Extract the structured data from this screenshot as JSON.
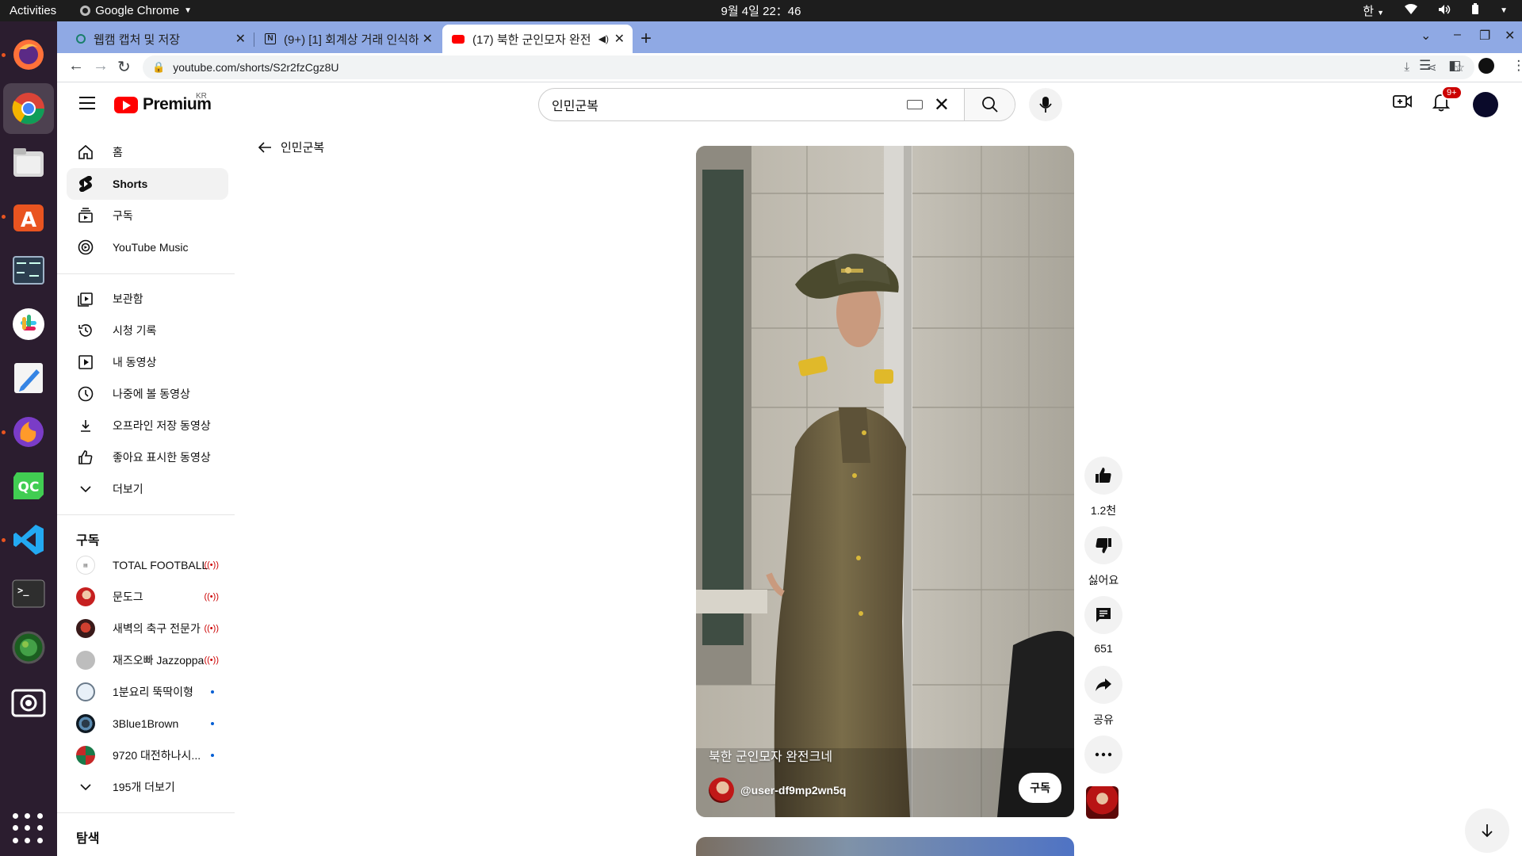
{
  "os_bar": {
    "activities": "Activities",
    "app_name": "Google Chrome",
    "clock": "9월 4일  22：46",
    "input_method": "한"
  },
  "browser": {
    "tabs": [
      {
        "title": "웹캠 캡처 및 저장"
      },
      {
        "title": "(9+) [1] 회계상 거래 인식하기"
      },
      {
        "title": "(17) 북한 군인모자 완전크네"
      }
    ],
    "url": "youtube.com/shorts/S2r2fzCgz8U"
  },
  "youtube": {
    "logo_text": "Premium",
    "region": "KR",
    "search_value": "인민군복",
    "notification_count": "9+",
    "back_label": "인민군복",
    "sidebar": {
      "main": [
        {
          "label": "홈"
        },
        {
          "label": "Shorts"
        },
        {
          "label": "구독"
        },
        {
          "label": "YouTube Music"
        }
      ],
      "library": [
        {
          "label": "보관함"
        },
        {
          "label": "시청 기록"
        },
        {
          "label": "내 동영상"
        },
        {
          "label": "나중에 볼 동영상"
        },
        {
          "label": "오프라인 저장 동영상"
        },
        {
          "label": "좋아요 표시한 동영상"
        },
        {
          "label": "더보기"
        }
      ],
      "subscriptions_heading": "구독",
      "subscriptions": [
        {
          "label": "TOTAL FOOTBALL",
          "status": "live"
        },
        {
          "label": "문도그",
          "status": "live"
        },
        {
          "label": "새벽의 축구 전문가",
          "status": "live"
        },
        {
          "label": "재즈오빠 Jazzoppa",
          "status": "live"
        },
        {
          "label": "1분요리 뚝딱이형",
          "status": "new"
        },
        {
          "label": "3Blue1Brown",
          "status": "new"
        },
        {
          "label": "9720 대전하나시...",
          "status": "new"
        }
      ],
      "show_more_subs": "195개 더보기",
      "explore_heading": "탐색"
    },
    "short": {
      "title": "북한 군인모자 완전크네",
      "channel": "@user-df9mp2wn5q",
      "subscribe_label": "구독",
      "likes": "1.2천",
      "dislike_label": "싫어요",
      "comments": "651",
      "share_label": "공유"
    }
  }
}
